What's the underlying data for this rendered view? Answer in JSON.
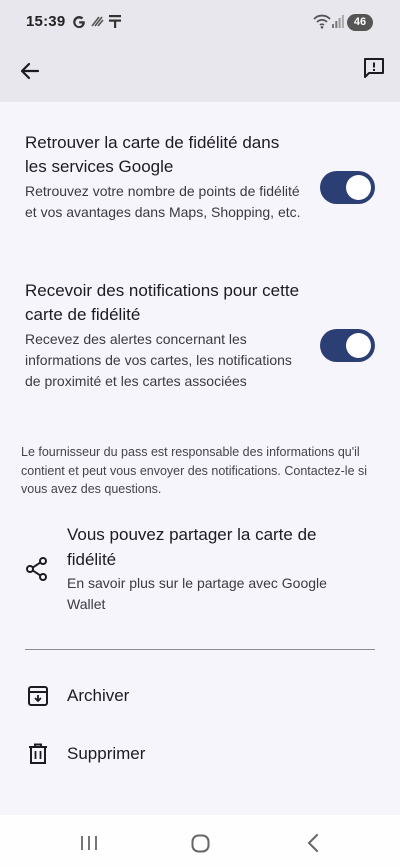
{
  "status_bar": {
    "time": "15:39",
    "battery": "46",
    "icons": [
      "google-g-icon",
      "call-icon",
      "notification-icon",
      "wifi-icon",
      "signal-icon"
    ]
  },
  "app_bar": {
    "back_icon": "arrow-back-icon",
    "feedback_icon": "feedback-icon"
  },
  "settings": [
    {
      "title": "Retrouver la carte de fidélité dans les services Google",
      "subtitle": "Retrouvez votre nombre de points de fidélité et vos avantages dans Maps, Shopping, etc.",
      "enabled": true
    },
    {
      "title": "Recevoir des notifications pour cette carte de fidélité",
      "subtitle": "Recevez des alertes concernant les informations de vos cartes, les notifications de proximité et les cartes associées",
      "enabled": true
    }
  ],
  "footnote": "Le fournisseur du pass est responsable des informations qu'il contient et peut vous envoyer des notifications. Contactez-le si vous avez des questions.",
  "share": {
    "icon": "share-icon",
    "title": "Vous pouvez partager la carte de fidélité",
    "subtitle": "En savoir plus sur le partage avec Google Wallet"
  },
  "actions": [
    {
      "icon": "archive-icon",
      "label": "Archiver"
    },
    {
      "icon": "delete-icon",
      "label": "Supprimer"
    }
  ],
  "nav_bar": {
    "icons": [
      "recent-apps-icon",
      "home-icon",
      "back-icon"
    ]
  },
  "colors": {
    "toggle_on": "#2c3f74",
    "header_bg": "#e8e7ed",
    "page_bg": "#f7f5fc"
  }
}
